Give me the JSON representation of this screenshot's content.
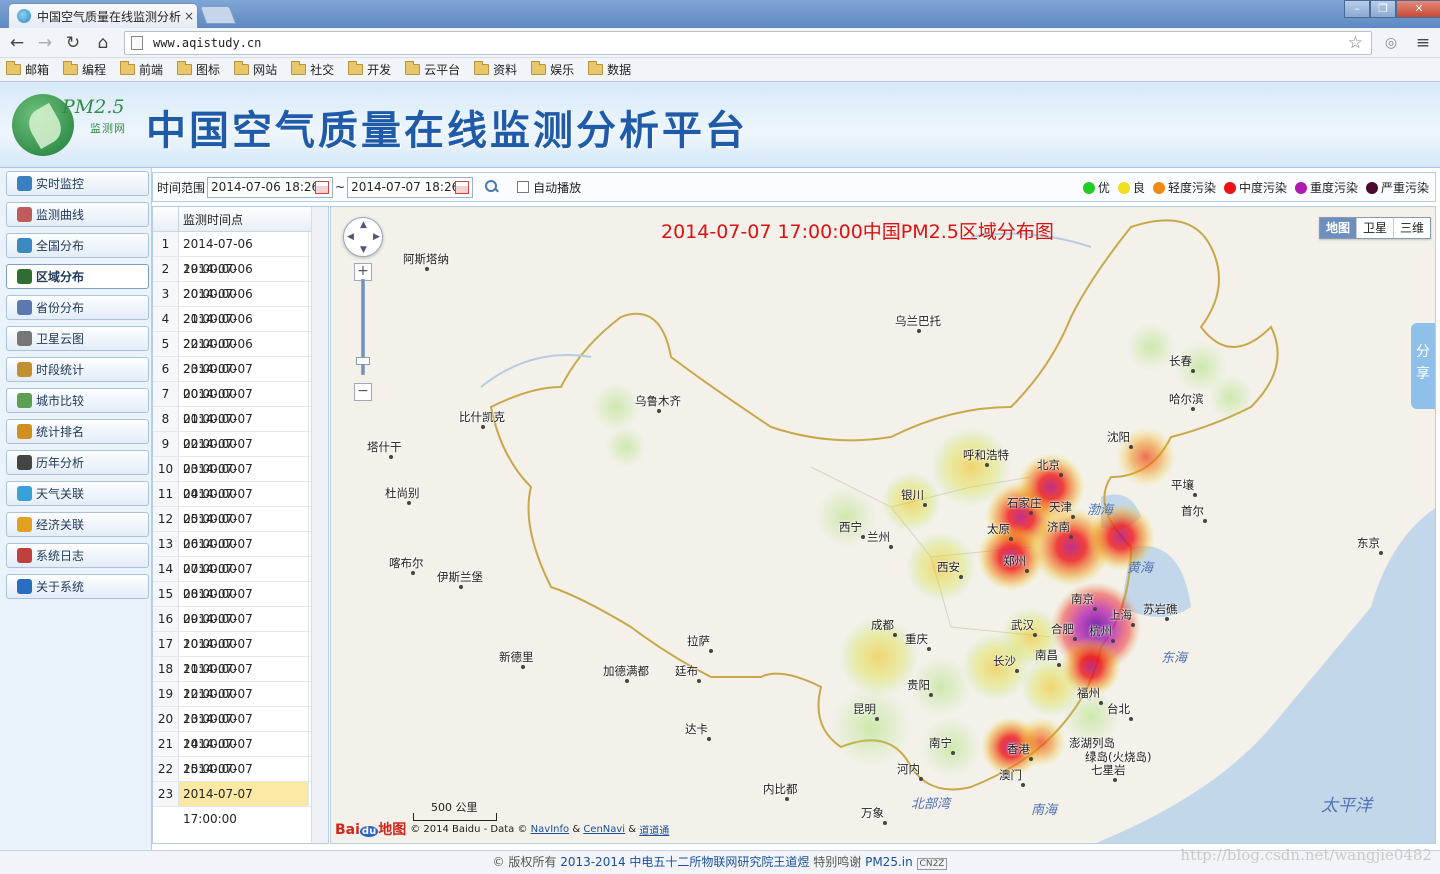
{
  "browser": {
    "tab_title": "中国空气质量在线监测分析",
    "tab_close": "×",
    "url": "www.aqistudy.cn",
    "window_controls": [
      "–",
      "❐",
      "✕"
    ],
    "nav": {
      "back": "←",
      "forward": "→",
      "reload": "↻",
      "home": "⌂"
    },
    "bookmarks": [
      "邮箱",
      "编程",
      "前端",
      "图标",
      "网站",
      "社交",
      "开发",
      "云平台",
      "资料",
      "娱乐",
      "数据"
    ]
  },
  "header": {
    "logo_text": "PM2.5",
    "logo_sub": "监测网",
    "title": "中国空气质量在线监测分析平台"
  },
  "sidebar": {
    "items": [
      {
        "label": "实时监控",
        "icon": "monitor-icon",
        "color": "#3a7fc0"
      },
      {
        "label": "监测曲线",
        "icon": "curve-icon",
        "color": "#c05b5b"
      },
      {
        "label": "全国分布",
        "icon": "nation-map-icon",
        "color": "#3a8ac0"
      },
      {
        "label": "区域分布",
        "icon": "region-map-icon",
        "color": "#2f6e2f"
      },
      {
        "label": "省份分布",
        "icon": "province-icon",
        "color": "#5b79b0"
      },
      {
        "label": "卫星云图",
        "icon": "satellite-icon",
        "color": "#777777"
      },
      {
        "label": "时段统计",
        "icon": "clock-icon",
        "color": "#c09030"
      },
      {
        "label": "城市比较",
        "icon": "city-icon",
        "color": "#5aa050"
      },
      {
        "label": "统计排名",
        "icon": "ranking-icon",
        "color": "#d09020"
      },
      {
        "label": "历年分析",
        "icon": "history-icon",
        "color": "#444444"
      },
      {
        "label": "天气关联",
        "icon": "weather-icon",
        "color": "#3aa0d8"
      },
      {
        "label": "经济关联",
        "icon": "economy-icon",
        "color": "#e0a020"
      },
      {
        "label": "系统日志",
        "icon": "log-icon",
        "color": "#c04040"
      },
      {
        "label": "关于系统",
        "icon": "info-icon",
        "color": "#2a6fbf"
      }
    ],
    "active_index": 3
  },
  "filter": {
    "label": "时间范围",
    "start": "2014-07-06 18:26",
    "separator": "~",
    "end": "2014-07-07 18:26",
    "autoplay_label": "自动播放"
  },
  "legend": [
    {
      "label": "优",
      "color": "#22cc22"
    },
    {
      "label": "良",
      "color": "#f0e020"
    },
    {
      "label": "轻度污染",
      "color": "#f08a10"
    },
    {
      "label": "中度污染",
      "color": "#ee1111"
    },
    {
      "label": "重度污染",
      "color": "#b01ab0"
    },
    {
      "label": "严重污染",
      "color": "#4a0a30"
    }
  ],
  "timelist": {
    "header": "监测时间点",
    "selected_index": 22,
    "rows": [
      {
        "n": "1",
        "t": "2014-07-06 19:00:00"
      },
      {
        "n": "2",
        "t": "2014-07-06 20:00:00"
      },
      {
        "n": "3",
        "t": "2014-07-06 21:00:00"
      },
      {
        "n": "4",
        "t": "2014-07-06 22:00:00"
      },
      {
        "n": "5",
        "t": "2014-07-06 23:00:00"
      },
      {
        "n": "6",
        "t": "2014-07-07 00:00:00"
      },
      {
        "n": "7",
        "t": "2014-07-07 01:00:00"
      },
      {
        "n": "8",
        "t": "2014-07-07 02:00:00"
      },
      {
        "n": "9",
        "t": "2014-07-07 03:00:00"
      },
      {
        "n": "10",
        "t": "2014-07-07 04:00:00"
      },
      {
        "n": "11",
        "t": "2014-07-07 05:00:00"
      },
      {
        "n": "12",
        "t": "2014-07-07 06:00:00"
      },
      {
        "n": "13",
        "t": "2014-07-07 07:00:00"
      },
      {
        "n": "14",
        "t": "2014-07-07 08:00:00"
      },
      {
        "n": "15",
        "t": "2014-07-07 09:00:00"
      },
      {
        "n": "16",
        "t": "2014-07-07 10:00:00"
      },
      {
        "n": "17",
        "t": "2014-07-07 11:00:00"
      },
      {
        "n": "18",
        "t": "2014-07-07 12:00:00"
      },
      {
        "n": "19",
        "t": "2014-07-07 13:00:00"
      },
      {
        "n": "20",
        "t": "2014-07-07 14:00:00"
      },
      {
        "n": "21",
        "t": "2014-07-07 15:00:00"
      },
      {
        "n": "22",
        "t": "2014-07-07 16:00:00"
      },
      {
        "n": "23",
        "t": "2014-07-07 17:00:00"
      }
    ]
  },
  "map": {
    "title": "2014-07-07 17:00:00中国PM2.5区域分布图",
    "types": [
      "地图",
      "卫星",
      "三维"
    ],
    "share": "分享",
    "scale": "500 公里",
    "copyright_prefix": "© 2014 Baidu - Data ©",
    "copyright_links": [
      "NavInfo",
      "&",
      "CenNavi",
      "&",
      "道道通"
    ],
    "baidu_logo": "Bai",
    "baidu_logo_mid": "du",
    "baidu_logo_suffix": "地图",
    "cities": [
      "阿斯塔纳",
      "乌兰巴托",
      "乌鲁木齐",
      "比什凯克",
      "塔什干",
      "杜尚别",
      "喀布尔",
      "伊斯兰堡",
      "新德里",
      "加德满都",
      "廷布",
      "拉萨",
      "达卡",
      "内比都",
      "万象",
      "河内",
      "南宁",
      "昆明",
      "贵阳",
      "成都",
      "重庆",
      "西宁",
      "兰州",
      "银川",
      "西安",
      "呼和浩特",
      "北京",
      "天津",
      "石家庄",
      "太原",
      "济南",
      "郑州",
      "南京",
      "上海",
      "杭州",
      "合肥",
      "武汉",
      "长沙",
      "南昌",
      "福州",
      "台北",
      "香港",
      "澳门",
      "沈阳",
      "长春",
      "哈尔滨",
      "平壤",
      "首尔",
      "东京",
      "苏岩礁",
      "澎湖列岛",
      "绿岛(火烧岛)",
      "七星岩"
    ],
    "seas": [
      "渤海",
      "黄海",
      "东海",
      "南海",
      "北部湾",
      "太平洋"
    ]
  },
  "footer": {
    "text1": "© 版权所有",
    "text2": "2013-2014 中电五十二所物联网研究院王道煜",
    "text3": "特别鸣谢",
    "text4": "PM25.in",
    "text5": "CN2Z"
  },
  "watermark": "http://blog.csdn.net/wangjie0482"
}
